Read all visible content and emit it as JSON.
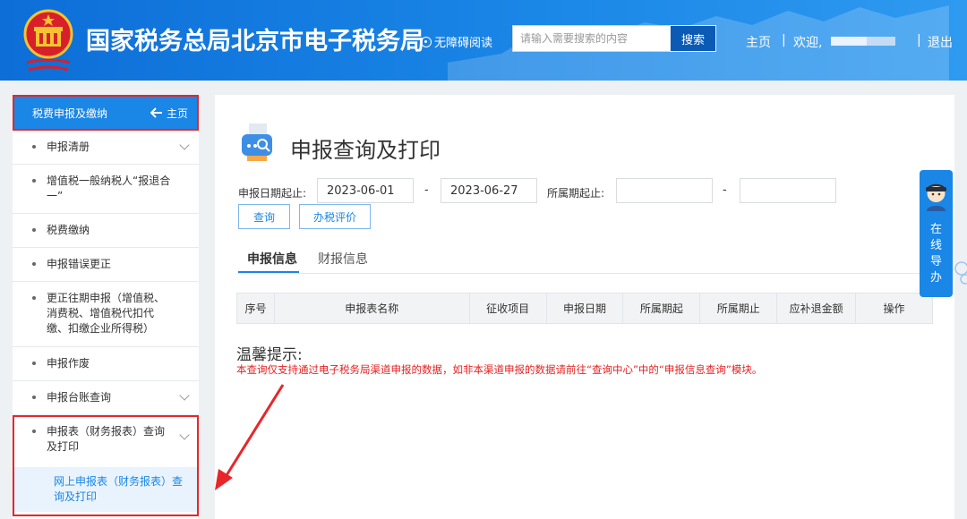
{
  "header": {
    "site_title": "国家税务总局北京市电子税务局",
    "accessibility": "无障碍阅读",
    "search_placeholder": "请输入需要搜索的内容",
    "search_button": "搜索",
    "home": "主页",
    "sep": "|",
    "welcome": "欢迎,",
    "logout": "退出",
    "brand_color": "#1a86e6"
  },
  "sidebar": {
    "head_title": "税费申报及缴纳",
    "head_home": "主页",
    "items": [
      {
        "label": "申报清册"
      },
      {
        "label": "增值税一般纳税人“报退合一”"
      },
      {
        "label": "税费缴纳"
      },
      {
        "label": "申报错误更正"
      },
      {
        "label": "更正往期申报（增值税、消费税、增值税代扣代缴、扣缴企业所得税）"
      },
      {
        "label": "申报作废"
      },
      {
        "label": "申报台账查询"
      },
      {
        "label": "申报表（财务报表）查询及打印"
      }
    ],
    "sub_item": "网上申报表（财务报表）查询及打印",
    "highlight_color": "#e8262a"
  },
  "main": {
    "title": "申报查询及打印",
    "filters": {
      "report_date_label": "申报日期起止:",
      "start_date": "2023-06-01",
      "dash": "-",
      "end_date": "2023-06-27",
      "period_label": "所属期起止:",
      "period_start": "",
      "period_end": ""
    },
    "buttons": {
      "query": "查询",
      "evaluate": "办税评价"
    },
    "tabs": [
      {
        "label": "申报信息",
        "active": true
      },
      {
        "label": "财报信息",
        "active": false
      }
    ],
    "table": {
      "columns": [
        "序号",
        "申报表名称",
        "征收项目",
        "申报日期",
        "所属期起",
        "所属期止",
        "应补退金额",
        "操作"
      ],
      "rows": []
    },
    "tips": {
      "title": "温馨提示:",
      "text": "本查询仅支持通过电子税务局渠道申报的数据，如非本渠道申报的数据请前往“查询中心”中的“申报信息查询”模块。"
    }
  },
  "guide": {
    "label": "在线导办"
  }
}
